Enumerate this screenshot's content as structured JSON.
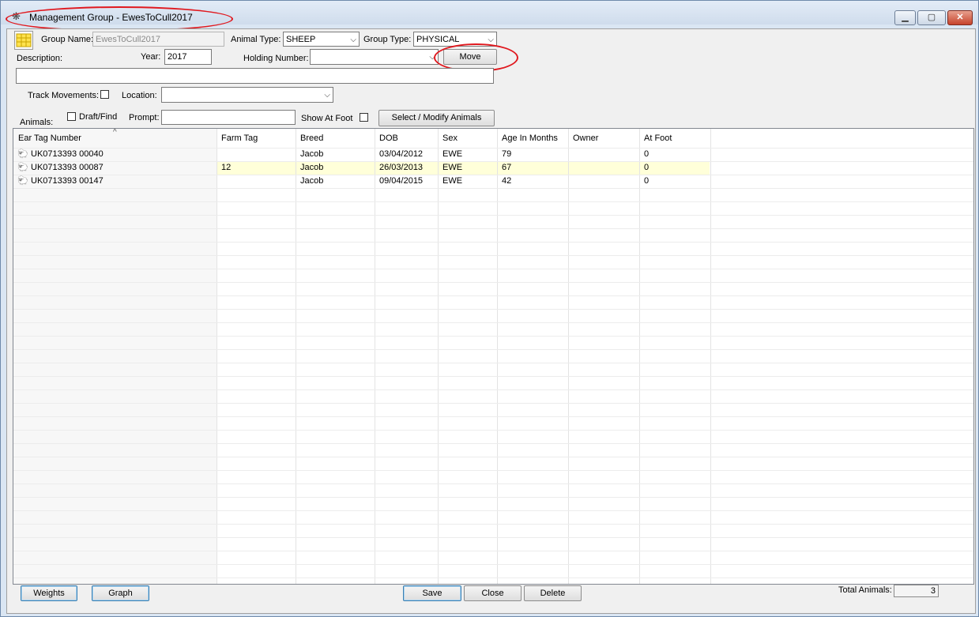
{
  "window": {
    "title": "Management Group - EwesToCull2017"
  },
  "form": {
    "group_name_label": "Group Name:",
    "group_name_value": "EwesToCull2017",
    "animal_type_label": "Animal Type:",
    "animal_type_value": "SHEEP",
    "group_type_label": "Group Type:",
    "group_type_value": "PHYSICAL",
    "description_label": "Description:",
    "description_value": "",
    "year_label": "Year:",
    "year_value": "2017",
    "holding_number_label": "Holding Number:",
    "holding_number_value": "",
    "move_label": "Move",
    "track_movements_label": "Track Movements:",
    "location_label": "Location:",
    "location_value": "",
    "animals_label": "Animals:",
    "draft_find_label": "Draft/Find",
    "prompt_label": "Prompt:",
    "prompt_value": "",
    "show_at_foot_label": "Show At Foot",
    "select_modify_label": "Select / Modify Animals"
  },
  "grid": {
    "sort_glyph": "^",
    "columns": [
      "Ear Tag Number",
      "Farm Tag",
      "Breed",
      "DOB",
      "Sex",
      "Age In Months",
      "Owner",
      "At Foot"
    ],
    "rows": [
      [
        "UK0713393 00040",
        "",
        "Jacob",
        "03/04/2012",
        "EWE",
        "79",
        "",
        "0"
      ],
      [
        "UK0713393 00087",
        "12",
        "Jacob",
        "26/03/2013",
        "EWE",
        "67",
        "",
        "0"
      ],
      [
        "UK0713393 00147",
        "",
        "Jacob",
        "09/04/2015",
        "EWE",
        "42",
        "",
        "0"
      ]
    ],
    "highlight_color": "#ffffd9"
  },
  "footer": {
    "weights_label": "Weights",
    "graph_label": "Graph",
    "save_label": "Save",
    "close_label": "Close",
    "delete_label": "Delete",
    "total_animals_label": "Total Animals:",
    "total_animals_value": "3"
  },
  "colors": {
    "annotation_red": "#e0191f",
    "window_frame": "#dae6f3"
  }
}
